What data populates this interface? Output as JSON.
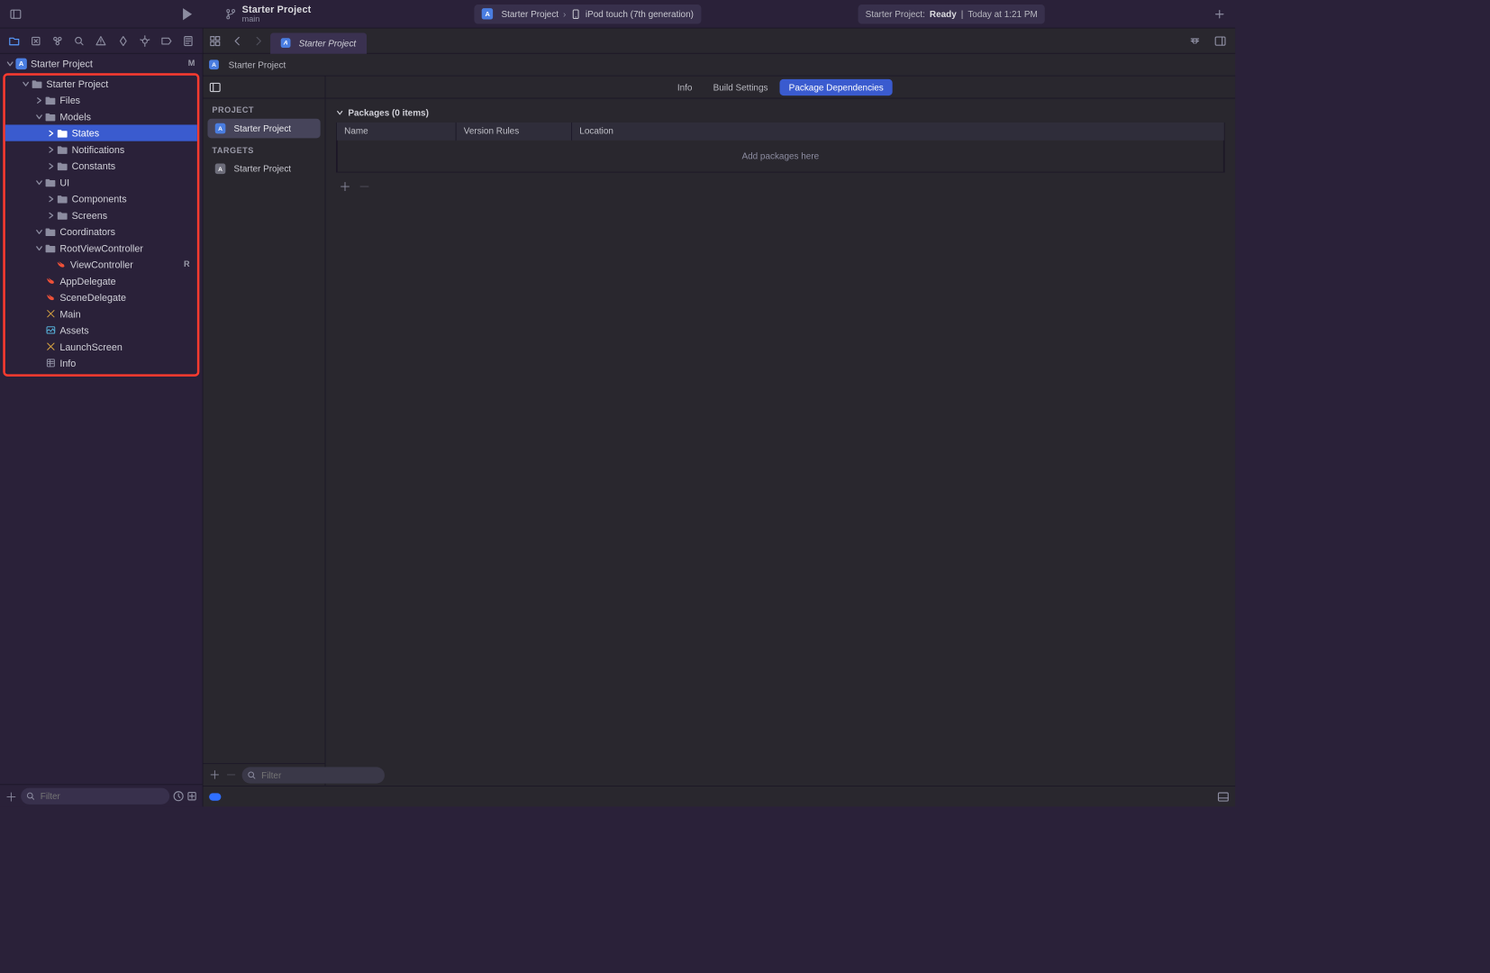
{
  "toolbar": {
    "project_title": "Starter Project",
    "branch": "main",
    "scheme_project": "Starter Project",
    "scheme_device": "iPod touch (7th generation)",
    "status_prefix": "Starter Project:",
    "status_state": "Ready",
    "status_time": "Today at 1:21 PM"
  },
  "navigator": {
    "root": {
      "name": "Starter Project",
      "badge": "M"
    },
    "group": {
      "name": "Starter Project",
      "children": [
        {
          "name": "Files",
          "type": "folder",
          "closed": true
        },
        {
          "name": "Models",
          "type": "folder",
          "open": true,
          "children": [
            {
              "name": "States",
              "type": "folder",
              "closed": true,
              "selected": true
            },
            {
              "name": "Notifications",
              "type": "folder",
              "closed": true
            },
            {
              "name": "Constants",
              "type": "folder",
              "closed": true
            }
          ]
        },
        {
          "name": "UI",
          "type": "folder",
          "open": true,
          "children": [
            {
              "name": "Components",
              "type": "folder",
              "closed": true
            },
            {
              "name": "Screens",
              "type": "folder",
              "closed": true
            }
          ]
        },
        {
          "name": "Coordinators",
          "type": "folder",
          "open": true
        },
        {
          "name": "RootViewController",
          "type": "folder",
          "open": true,
          "children": [
            {
              "name": "ViewController",
              "type": "swift",
              "badge": "R"
            }
          ]
        },
        {
          "name": "AppDelegate",
          "type": "swift"
        },
        {
          "name": "SceneDelegate",
          "type": "swift"
        },
        {
          "name": "Main",
          "type": "storyboard"
        },
        {
          "name": "Assets",
          "type": "assets"
        },
        {
          "name": "LaunchScreen",
          "type": "storyboard"
        },
        {
          "name": "Info",
          "type": "plist"
        }
      ]
    },
    "filter_placeholder": "Filter"
  },
  "editor": {
    "tab_label": "Starter Project",
    "crumb": "Starter Project",
    "outline": {
      "project_header": "PROJECT",
      "project_item": "Starter Project",
      "targets_header": "TARGETS",
      "target_item": "Starter Project",
      "filter_placeholder": "Filter"
    },
    "segments": {
      "info": "Info",
      "build": "Build Settings",
      "deps": "Package Dependencies"
    },
    "packages": {
      "header": "Packages (0 items)",
      "col_name": "Name",
      "col_version": "Version Rules",
      "col_location": "Location",
      "empty": "Add packages here"
    }
  }
}
